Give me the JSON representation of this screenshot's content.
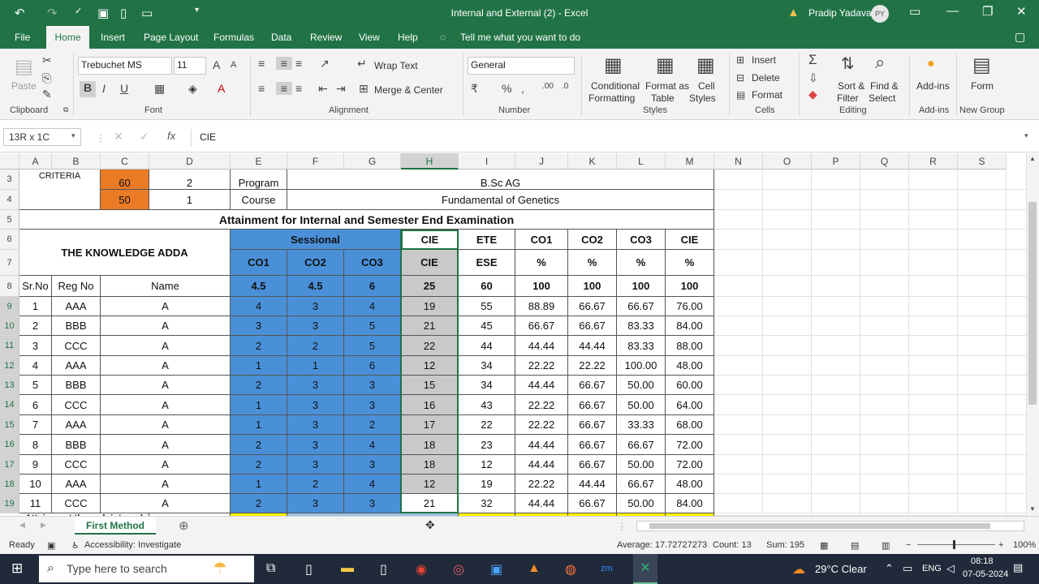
{
  "window": {
    "title": "Internal and External (2)  -  Excel",
    "user": "Pradip Yadava",
    "avatar": "PY"
  },
  "menu": [
    "File",
    "Home",
    "Insert",
    "Page Layout",
    "Formulas",
    "Data",
    "Review",
    "View",
    "Help",
    "Tell me what you want to do"
  ],
  "ribbon": {
    "font_name": "Trebuchet MS",
    "font_size": "11",
    "wrap": "Wrap Text",
    "merge": "Merge & Center",
    "number_format": "General",
    "cond": "Conditional",
    "cond2": "Formatting",
    "fmt_table": "Format as",
    "fmt_table2": "Table",
    "cell_styles": "Cell",
    "cell_styles2": "Styles",
    "insert": "Insert",
    "delete": "Delete",
    "format": "Format",
    "sort": "Sort &",
    "sort2": "Filter",
    "find": "Find &",
    "find2": "Select",
    "addins": "Add-ins",
    "form": "Form",
    "paste": "Paste",
    "groups": {
      "clipboard": "Clipboard",
      "font": "Font",
      "alignment": "Alignment",
      "number": "Number",
      "styles": "Styles",
      "cells": "Cells",
      "editing": "Editing",
      "addins": "Add-ins",
      "newgroup": "New Group"
    }
  },
  "formula_bar": {
    "name_box": "13R x 1C",
    "fx": "fx",
    "content": "CIE"
  },
  "columns": [
    "A",
    "B",
    "C",
    "D",
    "E",
    "F",
    "G",
    "H",
    "I",
    "J",
    "K",
    "L",
    "M",
    "N",
    "O",
    "P",
    "Q",
    "R",
    "S"
  ],
  "rows": [
    "3",
    "4",
    "5",
    "6",
    "7",
    "8",
    "9",
    "10",
    "11",
    "12",
    "13",
    "14",
    "15",
    "16",
    "17",
    "18",
    "19"
  ],
  "sheet": {
    "criteria": "CRITERIA",
    "c3": "60",
    "d3": "2",
    "e3": "Program",
    "title3": "B.Sc AG",
    "c4": "50",
    "d4": "1",
    "e4": "Course",
    "title4": "Fundamental of Genetics",
    "heading": "Attainment for Internal and Semester End Examination",
    "org": "THE KNOWLEDGE ADDA",
    "sessional": "Sessional",
    "hdr6": [
      "CIE",
      "ETE",
      "CO1",
      "CO2",
      "CO3",
      "CIE"
    ],
    "hdr7": [
      "CO1",
      "CO2",
      "CO3",
      "CIE",
      "ESE",
      "%",
      "%",
      "%",
      "%"
    ],
    "hdr8": [
      "Sr.No",
      "Reg No",
      "Name",
      "4.5",
      "4.5",
      "6",
      "25",
      "60",
      "100",
      "100",
      "100",
      "100"
    ],
    "data": [
      [
        "1",
        "AAA",
        "A",
        "4",
        "3",
        "4",
        "19",
        "55",
        "88.89",
        "66.67",
        "66.67",
        "76.00"
      ],
      [
        "2",
        "BBB",
        "A",
        "3",
        "3",
        "5",
        "21",
        "45",
        "66.67",
        "66.67",
        "83.33",
        "84.00"
      ],
      [
        "3",
        "CCC",
        "A",
        "2",
        "2",
        "5",
        "22",
        "44",
        "44.44",
        "44.44",
        "83.33",
        "88.00"
      ],
      [
        "4",
        "AAA",
        "A",
        "1",
        "1",
        "6",
        "12",
        "34",
        "22.22",
        "22.22",
        "100.00",
        "48.00"
      ],
      [
        "5",
        "BBB",
        "A",
        "2",
        "3",
        "3",
        "15",
        "34",
        "44.44",
        "66.67",
        "50.00",
        "60.00"
      ],
      [
        "6",
        "CCC",
        "A",
        "1",
        "3",
        "3",
        "16",
        "43",
        "22.22",
        "66.67",
        "50.00",
        "64.00"
      ],
      [
        "7",
        "AAA",
        "A",
        "1",
        "3",
        "2",
        "17",
        "22",
        "22.22",
        "66.67",
        "33.33",
        "68.00"
      ],
      [
        "8",
        "BBB",
        "A",
        "2",
        "3",
        "4",
        "18",
        "23",
        "44.44",
        "66.67",
        "66.67",
        "72.00"
      ],
      [
        "9",
        "CCC",
        "A",
        "2",
        "3",
        "3",
        "18",
        "12",
        "44.44",
        "66.67",
        "50.00",
        "72.00"
      ],
      [
        "10",
        "AAA",
        "A",
        "1",
        "2",
        "4",
        "12",
        "19",
        "22.22",
        "44.44",
        "66.67",
        "48.00"
      ],
      [
        "11",
        "CCC",
        "A",
        "2",
        "3",
        "3",
        "21",
        "32",
        "44.44",
        "66.67",
        "50.00",
        "84.00"
      ]
    ],
    "footer": "Attainment through internal"
  },
  "sheet_tab": "First Method",
  "status": {
    "ready": "Ready",
    "accessibility": "Accessibility: Investigate",
    "average": "Average: 17.72727273",
    "count": "Count: 13",
    "sum": "Sum: 195",
    "zoom": "100%"
  },
  "taskbar": {
    "search": "Type here to search",
    "weather": "29°C  Clear",
    "lang": "ENG",
    "time": "08:18",
    "date": "07-05-2024"
  }
}
